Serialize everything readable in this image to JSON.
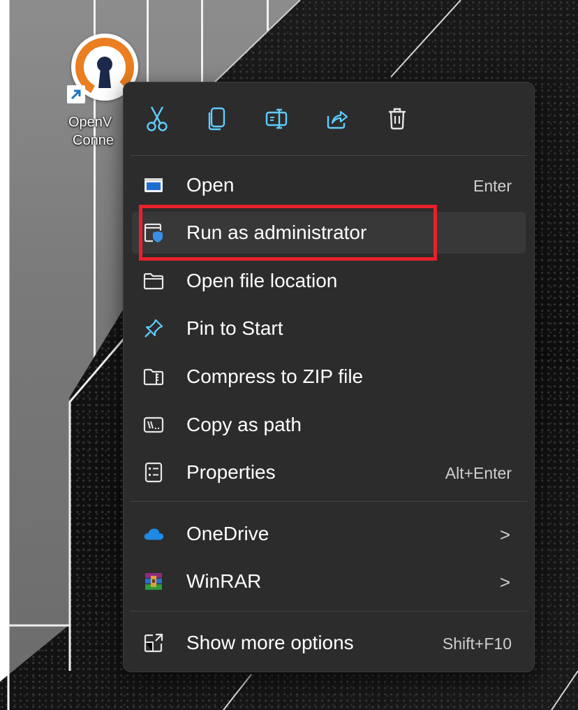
{
  "desktop": {
    "shortcut": {
      "name_line1": "OpenV",
      "name_line2": "Conne",
      "icon": "openvpn-logo-icon"
    }
  },
  "context_menu": {
    "quick_actions": [
      {
        "name": "cut",
        "icon": "scissors-icon"
      },
      {
        "name": "copy",
        "icon": "copy-icon"
      },
      {
        "name": "rename",
        "icon": "rename-icon"
      },
      {
        "name": "share",
        "icon": "share-icon"
      },
      {
        "name": "delete",
        "icon": "trash-icon"
      }
    ],
    "items": [
      {
        "label": "Open",
        "shortcut": "Enter",
        "icon": "open-window-icon"
      },
      {
        "label": "Run as administrator",
        "shortcut": "",
        "icon": "shield-window-icon"
      },
      {
        "label": "Open file location",
        "shortcut": "",
        "icon": "folder-icon"
      },
      {
        "label": "Pin to Start",
        "shortcut": "",
        "icon": "pin-icon"
      },
      {
        "label": "Compress to ZIP file",
        "shortcut": "",
        "icon": "zip-folder-icon"
      },
      {
        "label": "Copy as path",
        "shortcut": "",
        "icon": "path-icon"
      },
      {
        "label": "Properties",
        "shortcut": "Alt+Enter",
        "icon": "properties-icon"
      },
      {
        "label": "OneDrive",
        "shortcut": "",
        "icon": "onedrive-cloud-icon",
        "submenu": ">"
      },
      {
        "label": "WinRAR",
        "shortcut": "",
        "icon": "winrar-icon",
        "submenu": ">"
      },
      {
        "label": "Show more options",
        "shortcut": "Shift+F10",
        "icon": "more-options-icon"
      }
    ]
  },
  "colors": {
    "menu_bg": "#2c2c2c",
    "hover_bg": "#383838",
    "accent_blue": "#60cdff",
    "highlight_red": "#e8212a",
    "openvpn_orange": "#ea7e20",
    "openvpn_navy": "#1b2a4a"
  }
}
